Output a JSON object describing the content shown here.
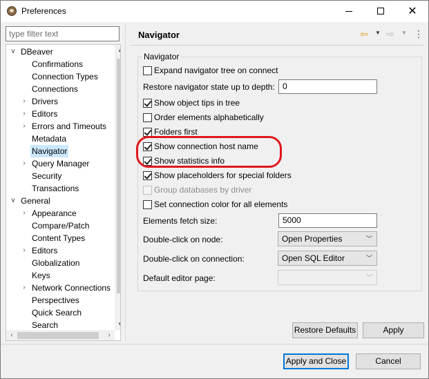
{
  "window": {
    "title": "Preferences",
    "minimize_glyph": "",
    "maximize_glyph": "",
    "close_glyph": "✕"
  },
  "sidebar": {
    "filter_placeholder": "type filter text",
    "tree": [
      {
        "label": "DBeaver",
        "level": 0,
        "arrow": "∨"
      },
      {
        "label": "Confirmations",
        "level": 1,
        "arrow": ""
      },
      {
        "label": "Connection Types",
        "level": 1,
        "arrow": ""
      },
      {
        "label": "Connections",
        "level": 1,
        "arrow": ""
      },
      {
        "label": "Drivers",
        "level": 1,
        "arrow": "›"
      },
      {
        "label": "Editors",
        "level": 1,
        "arrow": "›"
      },
      {
        "label": "Errors and Timeouts",
        "level": 1,
        "arrow": "›"
      },
      {
        "label": "Metadata",
        "level": 1,
        "arrow": ""
      },
      {
        "label": "Navigator",
        "level": 1,
        "arrow": "",
        "selected": true
      },
      {
        "label": "Query Manager",
        "level": 1,
        "arrow": "›"
      },
      {
        "label": "Security",
        "level": 1,
        "arrow": ""
      },
      {
        "label": "Transactions",
        "level": 1,
        "arrow": ""
      },
      {
        "label": "General",
        "level": 0,
        "arrow": "∨"
      },
      {
        "label": "Appearance",
        "level": 1,
        "arrow": "›"
      },
      {
        "label": "Compare/Patch",
        "level": 1,
        "arrow": ""
      },
      {
        "label": "Content Types",
        "level": 1,
        "arrow": ""
      },
      {
        "label": "Editors",
        "level": 1,
        "arrow": "›"
      },
      {
        "label": "Globalization",
        "level": 1,
        "arrow": ""
      },
      {
        "label": "Keys",
        "level": 1,
        "arrow": ""
      },
      {
        "label": "Network Connections",
        "level": 1,
        "arrow": "›"
      },
      {
        "label": "Perspectives",
        "level": 1,
        "arrow": ""
      },
      {
        "label": "Quick Search",
        "level": 1,
        "arrow": ""
      },
      {
        "label": "Search",
        "level": 1,
        "arrow": ""
      }
    ]
  },
  "page": {
    "title": "Navigator",
    "group_label": "Navigator",
    "checkboxes": [
      {
        "label": "Expand navigator tree on connect",
        "checked": false,
        "disabled": false
      },
      {
        "label": "Show object tips in tree",
        "checked": true,
        "disabled": false
      },
      {
        "label": "Order elements alphabetically",
        "checked": false,
        "disabled": false
      },
      {
        "label": "Folders first",
        "checked": true,
        "disabled": false
      },
      {
        "label": "Show connection host name",
        "checked": true,
        "disabled": false
      },
      {
        "label": "Show statistics info",
        "checked": true,
        "disabled": false
      },
      {
        "label": "Show placeholders for special folders",
        "checked": true,
        "disabled": false
      },
      {
        "label": "Group databases by driver",
        "checked": false,
        "disabled": true
      },
      {
        "label": "Set connection color for all elements",
        "checked": false,
        "disabled": false
      }
    ],
    "restore_depth_label": "Restore navigator state up to depth:",
    "restore_depth_value": "0",
    "fetch_size_label": "Elements fetch size:",
    "fetch_size_value": "5000",
    "double_click_node_label": "Double-click on node:",
    "double_click_node_value": "Open Properties",
    "double_click_conn_label": "Double-click on connection:",
    "double_click_conn_value": "Open SQL Editor",
    "default_editor_label": "Default editor page:",
    "default_editor_value": ""
  },
  "buttons": {
    "restore_defaults": "Restore Defaults",
    "apply": "Apply",
    "apply_and_close": "Apply and Close",
    "cancel": "Cancel"
  },
  "colors": {
    "highlight": "#e0161b",
    "selection": "#cce8ff",
    "default_button_border": "#0078d7"
  }
}
